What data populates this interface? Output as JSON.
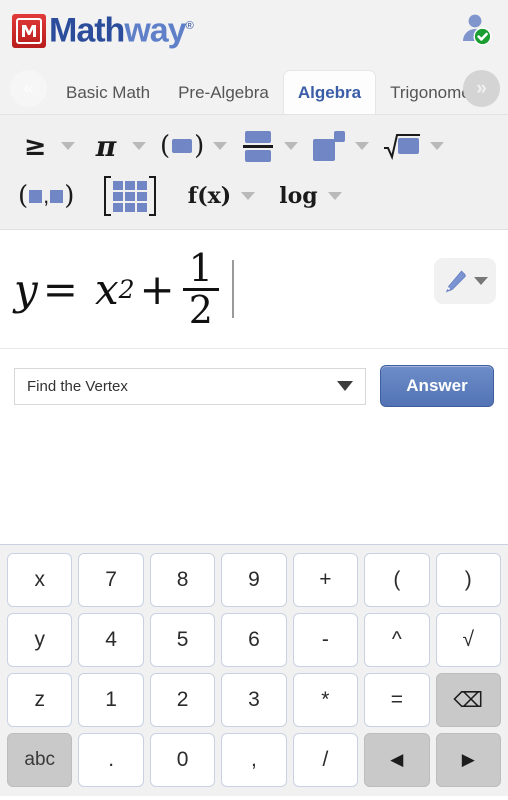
{
  "header": {
    "logo_icon": "mathway-m-icon",
    "brand_first": "Math",
    "brand_second": "way",
    "brand_tm": "®",
    "avatar_icon": "user-avatar-verified-icon"
  },
  "tabbar": {
    "scroll_left_icon": "chevron-double-left-icon",
    "scroll_left_label": "«",
    "scroll_right_icon": "chevron-double-right-icon",
    "scroll_right_label": "»",
    "tabs": [
      {
        "label": "Basic Math",
        "active": false
      },
      {
        "label": "Pre-Algebra",
        "active": false
      },
      {
        "label": "Algebra",
        "active": true
      },
      {
        "label": "Trigonomet",
        "active": false
      }
    ]
  },
  "toolbar": {
    "row1": [
      {
        "name": "inequality",
        "glyph": "≥",
        "has_caret": true
      },
      {
        "name": "pi-constant",
        "glyph": "π",
        "has_caret": true
      },
      {
        "name": "parentheses",
        "glyph": "(■)",
        "has_caret": true
      },
      {
        "name": "fraction",
        "glyph": "fraction",
        "has_caret": true
      },
      {
        "name": "exponent",
        "glyph": "exponent",
        "has_caret": true
      },
      {
        "name": "square-root",
        "glyph": "radical",
        "has_caret": true
      }
    ],
    "row2": [
      {
        "name": "ordered-pair",
        "glyph": "(■,■)",
        "has_caret": false
      },
      {
        "name": "matrix",
        "glyph": "matrix",
        "has_caret": false
      },
      {
        "name": "function",
        "glyph": "f(x)",
        "has_caret": true
      },
      {
        "name": "logarithm",
        "glyph": "log",
        "has_caret": true
      }
    ]
  },
  "expression": {
    "lhs": "y",
    "equals": "=",
    "base": "x",
    "exponent": "2",
    "plus": "+",
    "numerator": "1",
    "denominator": "2",
    "full_text": "y = x^2 + 1/2",
    "pencil_icon": "pencil-icon",
    "pencil_caret_icon": "chevron-down-icon"
  },
  "problem": {
    "selected": "Find the Vertex",
    "dropdown_icon": "chevron-down-icon",
    "answer_label": "Answer"
  },
  "keypad": {
    "rows": [
      [
        {
          "label": "x",
          "name": "key-x",
          "style": "light"
        },
        {
          "label": "7",
          "name": "key-7",
          "style": "light"
        },
        {
          "label": "8",
          "name": "key-8",
          "style": "light"
        },
        {
          "label": "9",
          "name": "key-9",
          "style": "light"
        },
        {
          "label": "+",
          "name": "key-plus",
          "style": "light"
        },
        {
          "label": "(",
          "name": "key-open-paren",
          "style": "light"
        },
        {
          "label": ")",
          "name": "key-close-paren",
          "style": "light"
        }
      ],
      [
        {
          "label": "y",
          "name": "key-y",
          "style": "light"
        },
        {
          "label": "4",
          "name": "key-4",
          "style": "light"
        },
        {
          "label": "5",
          "name": "key-5",
          "style": "light"
        },
        {
          "label": "6",
          "name": "key-6",
          "style": "light"
        },
        {
          "label": "-",
          "name": "key-minus",
          "style": "light"
        },
        {
          "label": "^",
          "name": "key-caret",
          "style": "light"
        },
        {
          "label": "√",
          "name": "key-sqrt",
          "style": "light"
        }
      ],
      [
        {
          "label": "z",
          "name": "key-z",
          "style": "light"
        },
        {
          "label": "1",
          "name": "key-1",
          "style": "light"
        },
        {
          "label": "2",
          "name": "key-2",
          "style": "light"
        },
        {
          "label": "3",
          "name": "key-3",
          "style": "light"
        },
        {
          "label": "*",
          "name": "key-multiply",
          "style": "light"
        },
        {
          "label": "=",
          "name": "key-equals",
          "style": "light"
        },
        {
          "label": "⌫",
          "name": "key-backspace",
          "style": "gray"
        }
      ],
      [
        {
          "label": "abc",
          "name": "key-abc",
          "style": "gray"
        },
        {
          "label": ".",
          "name": "key-period",
          "style": "light"
        },
        {
          "label": "0",
          "name": "key-0",
          "style": "light"
        },
        {
          "label": ",",
          "name": "key-comma",
          "style": "light"
        },
        {
          "label": "/",
          "name": "key-divide",
          "style": "light"
        },
        {
          "label": "◀",
          "name": "key-arrow-left",
          "style": "gray"
        },
        {
          "label": "▶",
          "name": "key-arrow-right",
          "style": "gray"
        }
      ]
    ]
  },
  "colors": {
    "brand_blue": "#2c4d9c",
    "brand_blue_light": "#5f80c8",
    "logo_red": "#c52222",
    "answer_blue": "#5273b4",
    "accent_box": "#7186c4",
    "verified_green": "#1a9e32"
  }
}
